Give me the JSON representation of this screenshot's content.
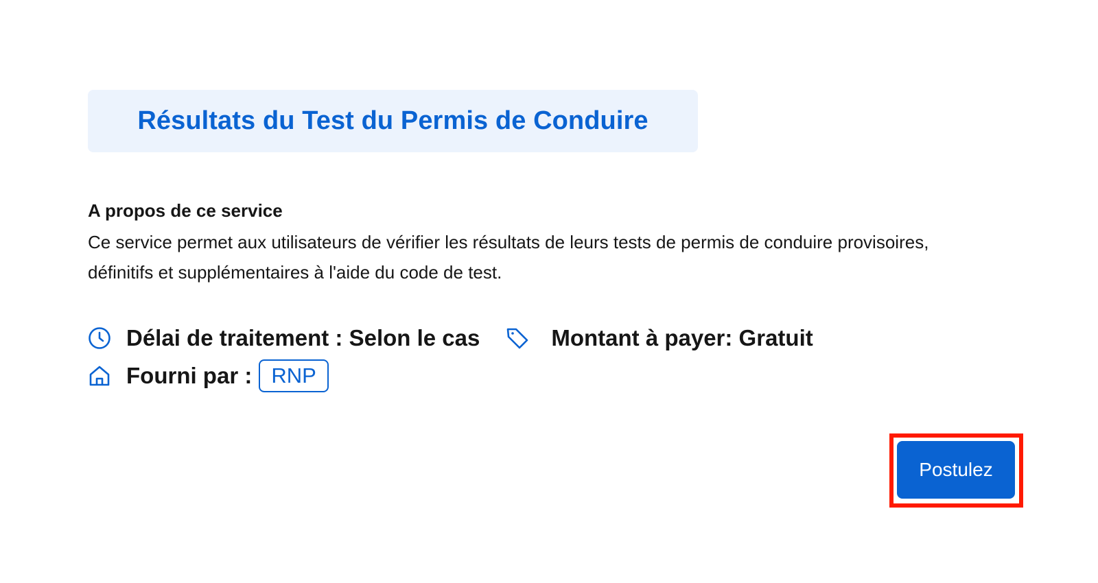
{
  "header": {
    "title": "Résultats du Test du Permis de Conduire"
  },
  "about": {
    "heading": "A propos de ce service",
    "description": "Ce service permet aux utilisateurs de vérifier les résultats de leurs tests de permis de conduire provisoires, définitifs et supplémentaires à l'aide du code de test."
  },
  "meta": {
    "processing_time": {
      "icon": "clock-icon",
      "text": "Délai de traitement : Selon le cas"
    },
    "amount": {
      "icon": "tag-icon",
      "text": "Montant à payer: Gratuit"
    },
    "provider": {
      "icon": "home-icon",
      "label": "Fourni par :",
      "value": "RNP"
    }
  },
  "actions": {
    "apply_label": "Postulez"
  },
  "colors": {
    "accent": "#0a63d2",
    "title_background": "#ecf3fd",
    "highlight": "#ff1a00"
  }
}
